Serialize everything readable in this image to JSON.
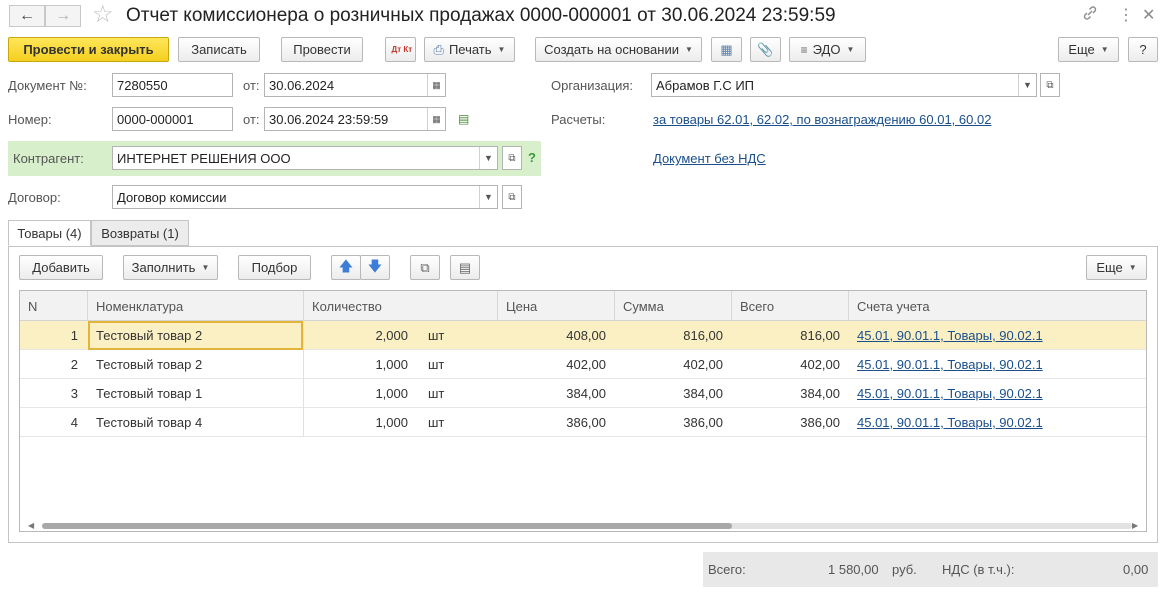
{
  "window": {
    "title": "Отчет комиссионера о розничных продажах 0000-000001 от 30.06.2024 23:59:59",
    "more_glyph": "⋮",
    "close_glyph": "✕"
  },
  "toolbar": {
    "post_close": "Провести и закрыть",
    "save": "Записать",
    "post": "Провести",
    "dtkt": "Дт Кт",
    "print": "Печать",
    "create_based": "Создать на основании",
    "edo": "ЭДО",
    "more": "Еще",
    "help": "?"
  },
  "form": {
    "doc_no_label": "Документ №:",
    "doc_no_value": "7280550",
    "from_label": "от:",
    "doc_date": "30.06.2024",
    "number_label": "Номер:",
    "number_value": "0000-000001",
    "number_date": "30.06.2024 23:59:59",
    "counterparty_label": "Контрагент:",
    "counterparty_value": "ИНТЕРНЕТ РЕШЕНИЯ ООО",
    "help_mark": "?",
    "contract_label": "Договор:",
    "contract_value": "Договор комиссии",
    "org_label": "Организация:",
    "org_value": "Абрамов Г.С ИП",
    "settlements_label": "Расчеты:",
    "settlements_link": "за товары 62.01, 62.02, по вознаграждению 60.01, 60.02",
    "vat_link": "Документ без НДС"
  },
  "tabs": [
    {
      "label": "Товары (4)",
      "active": true
    },
    {
      "label": "Возвраты (1)",
      "active": false
    }
  ],
  "table_toolbar": {
    "add": "Добавить",
    "fill": "Заполнить",
    "select": "Подбор",
    "more": "Еще"
  },
  "table": {
    "columns": [
      "N",
      "Номенклатура",
      "Количество",
      "Цена",
      "Сумма",
      "Всего",
      "Счета учета"
    ],
    "rows": [
      {
        "n": "1",
        "item": "Тестовый товар 2",
        "qty": "2,000",
        "unit": "шт",
        "price": "408,00",
        "sum": "816,00",
        "total": "816,00",
        "accounts": "45.01, 90.01.1, Товары, 90.02.1"
      },
      {
        "n": "2",
        "item": "Тестовый товар 2",
        "qty": "1,000",
        "unit": "шт",
        "price": "402,00",
        "sum": "402,00",
        "total": "402,00",
        "accounts": "45.01, 90.01.1, Товары, 90.02.1"
      },
      {
        "n": "3",
        "item": "Тестовый товар 1",
        "qty": "1,000",
        "unit": "шт",
        "price": "384,00",
        "sum": "384,00",
        "total": "384,00",
        "accounts": "45.01, 90.01.1, Товары, 90.02.1"
      },
      {
        "n": "4",
        "item": "Тестовый товар 4",
        "qty": "1,000",
        "unit": "шт",
        "price": "386,00",
        "sum": "386,00",
        "total": "386,00",
        "accounts": "45.01, 90.01.1, Товары, 90.02.1"
      }
    ]
  },
  "footer": {
    "total_label": "Всего:",
    "total_value": "1 580,00",
    "currency": "руб.",
    "vat_label": "НДС (в т.ч.):",
    "vat_value": "0,00"
  }
}
